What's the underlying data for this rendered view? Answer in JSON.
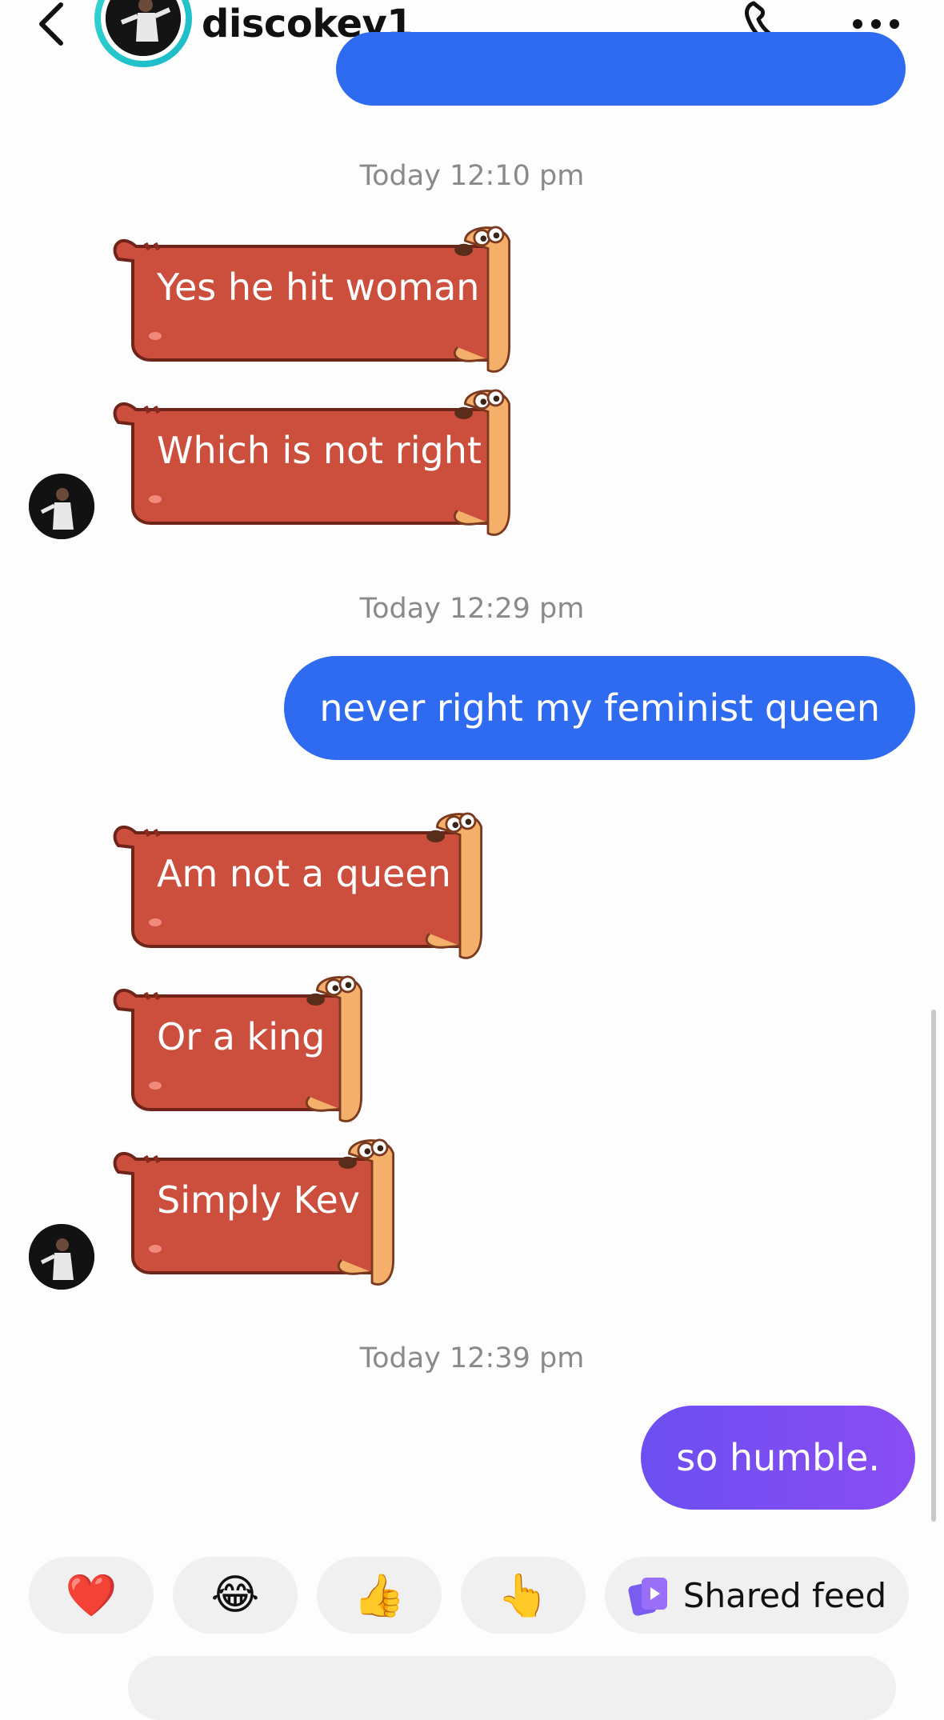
{
  "header": {
    "username": "discokev1",
    "back_icon": "chevron-left-icon",
    "call_icon": "phone-icon",
    "more_icon": "more-horizontal-icon"
  },
  "messages": {
    "timestamp_1": "Today 12:10 pm",
    "sticker_1": "Yes he hit woman",
    "sticker_2": "Which is not right",
    "timestamp_2": "Today 12:29 pm",
    "outgoing_1": "never right my feminist queen",
    "sticker_3": "Am not a queen",
    "sticker_4": "Or a king",
    "sticker_5": "Simply Kev",
    "timestamp_3": "Today 12:39 pm",
    "outgoing_2": "so humble."
  },
  "quick_reactions": {
    "heart": "❤️",
    "laugh": "😂",
    "thumbs_up": "👍",
    "point": "👆",
    "shared_feed_label": "Shared feed"
  },
  "colors": {
    "outgoing_blue": "#2f6bf0",
    "outgoing_purple": "#7a4ef2",
    "sticker_red": "#cc4f3e",
    "sticker_dog": "#f4b06b",
    "timestamp_gray": "#8a8a8a"
  }
}
